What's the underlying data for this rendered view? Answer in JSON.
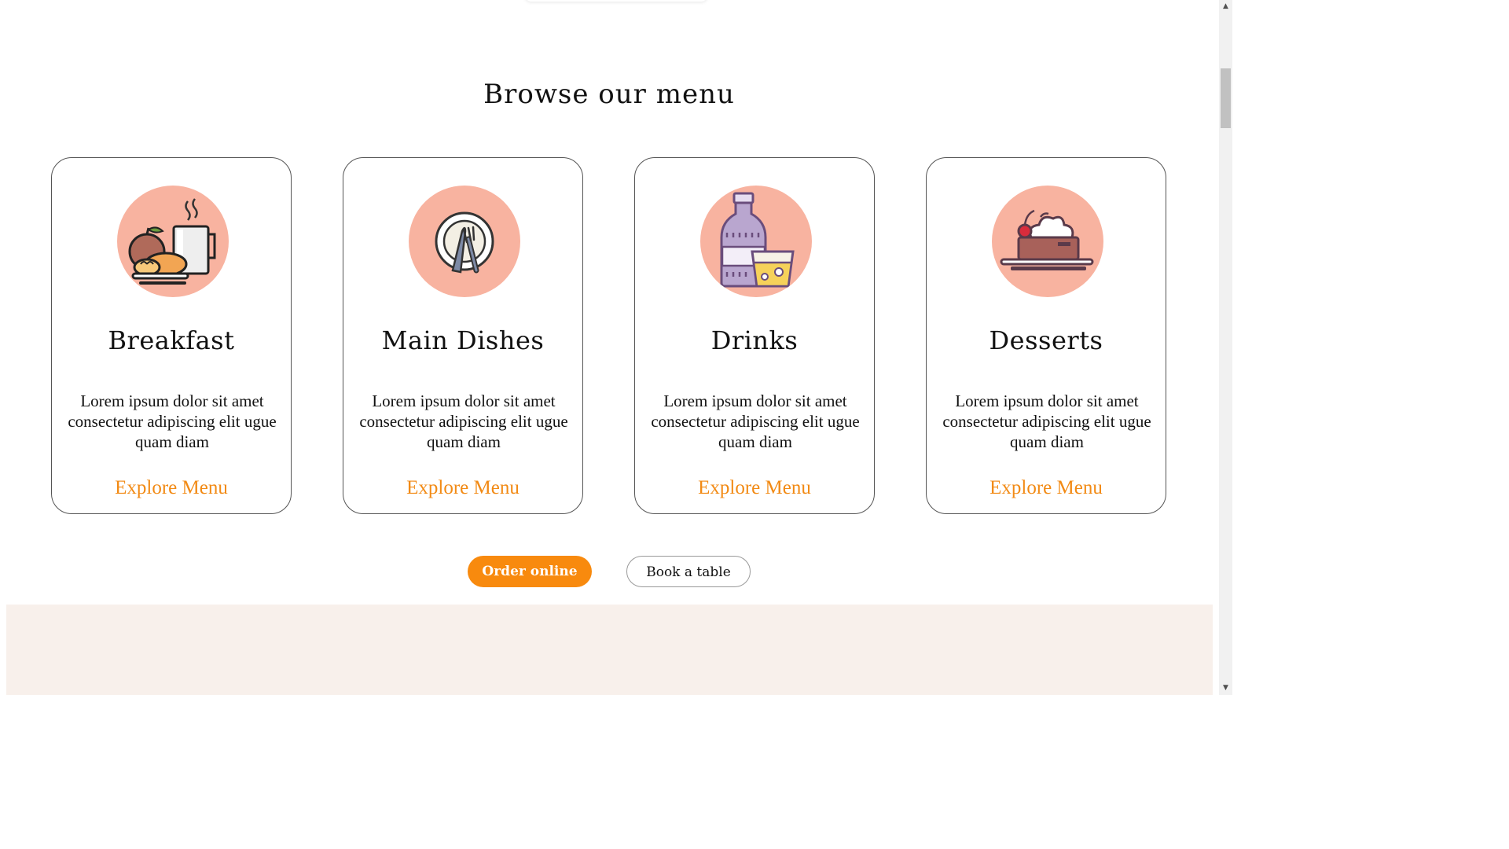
{
  "section": {
    "heading": "Browse our menu"
  },
  "cards": [
    {
      "title": "Breakfast",
      "icon": "breakfast-icon",
      "description": "Lorem ipsum dolor sit amet consectetur adipiscing elit ugue quam diam",
      "link_label": "Explore Menu"
    },
    {
      "title": "Main Dishes",
      "icon": "plate-cutlery-icon",
      "description": "Lorem ipsum dolor sit amet consectetur adipiscing elit ugue quam diam",
      "link_label": "Explore Menu"
    },
    {
      "title": "Drinks",
      "icon": "drinks-icon",
      "description": "Lorem ipsum dolor sit amet consectetur adipiscing elit ugue quam diam",
      "link_label": "Explore Menu"
    },
    {
      "title": "Desserts",
      "icon": "dessert-cake-icon",
      "description": "Lorem ipsum dolor sit amet consectetur adipiscing elit ugue quam diam",
      "link_label": "Explore Menu"
    }
  ],
  "actions": {
    "order_label": "Order online",
    "book_label": "Book a table"
  },
  "colors": {
    "accent": "#f88a0e",
    "link": "#f28a14",
    "icon_bg": "#f8b3a0",
    "band_bg": "#f8f0eb"
  }
}
